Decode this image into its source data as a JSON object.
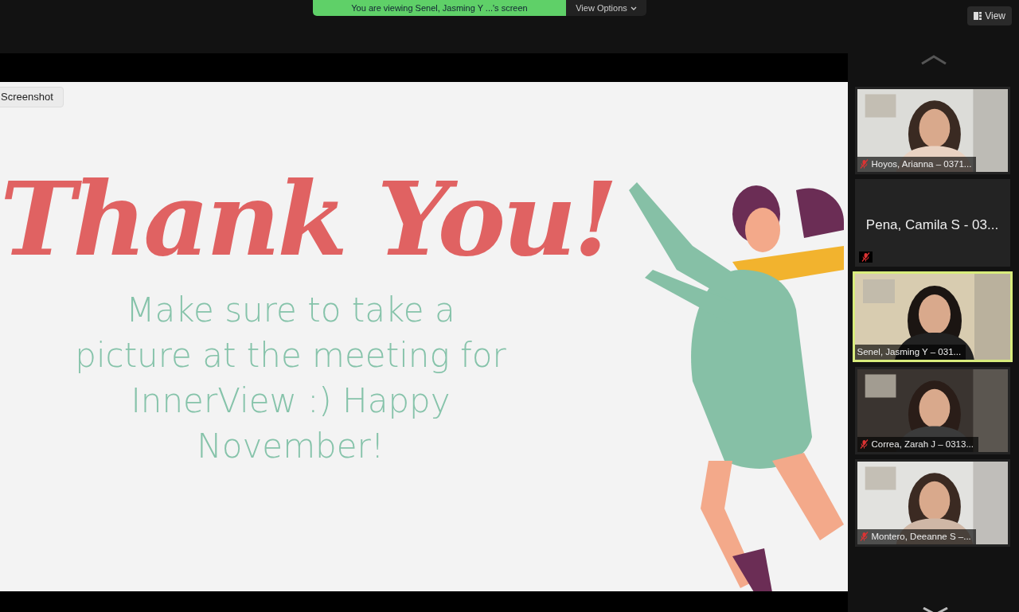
{
  "banner": {
    "text": "You are viewing Senel, Jasming Y ...'s screen",
    "options": "View Options"
  },
  "view_button": {
    "label": "View"
  },
  "screenshot_button": {
    "label": "Screenshot"
  },
  "slide": {
    "title": "Thank You!",
    "message": "Make sure to take a picture at the meeting for InnerView :) Happy November!"
  },
  "participants": [
    {
      "name": "Hoyos, Arianna – 0371...",
      "kind": "video",
      "muted": true,
      "selected": false
    },
    {
      "name": "Pena, Camila S - 03...",
      "kind": "name",
      "muted": true,
      "selected": false
    },
    {
      "name": "Senel, Jasming Y – 031...",
      "kind": "video",
      "muted": false,
      "selected": true
    },
    {
      "name": "Correa, Zarah J – 0313...",
      "kind": "video",
      "muted": true,
      "selected": false
    },
    {
      "name": "Montero, Deeanne S –...",
      "kind": "video",
      "muted": true,
      "selected": false
    }
  ]
}
